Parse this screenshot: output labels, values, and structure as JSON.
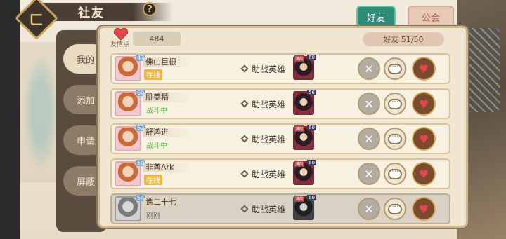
{
  "header": {
    "title": "社友",
    "help": "?"
  },
  "tabs": [
    {
      "label": "好友"
    },
    {
      "label": "公会"
    }
  ],
  "side_menu": [
    {
      "label": "我的"
    },
    {
      "label": "添加"
    },
    {
      "label": "申请"
    },
    {
      "label": "屏蔽"
    }
  ],
  "summary": {
    "points_label": "友情点",
    "points_value": "484",
    "friend_count": "好友 51/50"
  },
  "friends": [
    {
      "name": "佛山巨根",
      "status": "在线",
      "status_type": "online",
      "level": "47",
      "helper_label": "助战英雄",
      "hero_level": "60",
      "hero_tag": "满阶"
    },
    {
      "name": "肌美精",
      "status": "战斗中",
      "status_type": "battle",
      "level": "60",
      "helper_label": "助战英雄",
      "hero_level": "56",
      "hero_tag": ""
    },
    {
      "name": "舒鸿进",
      "status": "战斗中",
      "status_type": "battle",
      "level": "52",
      "helper_label": "助战英雄",
      "hero_level": "60",
      "hero_tag": "满阶"
    },
    {
      "name": "非酋Ark",
      "status": "在线",
      "status_type": "online",
      "level": "50",
      "helper_label": "助战英雄",
      "hero_level": "60",
      "hero_tag": "满阶"
    },
    {
      "name": "谯二十七",
      "status": "刚刚",
      "status_type": "offline",
      "level": "54",
      "helper_label": "助战英雄",
      "hero_level": "60",
      "hero_tag": "满阶"
    }
  ],
  "icons": [
    "back-icon",
    "help-icon",
    "heart-icon",
    "swords-icon",
    "chat-bubble-icon",
    "gift-heart-icon",
    "diamond-icon"
  ],
  "colors": {
    "tab_active": "#2f8b78",
    "online": "#f0b73c",
    "battle": "#5db84a",
    "panel": "#f0e6d2"
  }
}
